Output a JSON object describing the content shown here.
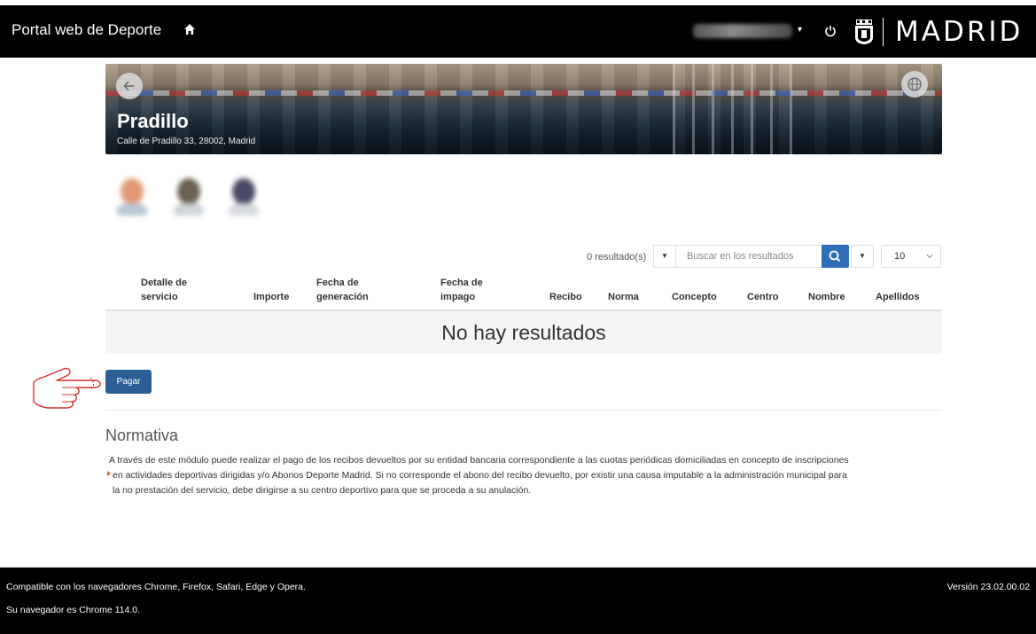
{
  "header": {
    "app_title": "Portal web de Deporte",
    "brand_name": "MADRID",
    "icons": [
      "home-icon",
      "caret-down-icon",
      "power-icon",
      "madrid-crest-icon"
    ]
  },
  "facility": {
    "name": "Pradillo",
    "address": "Calle de Pradillo 33, 28002, Madrid",
    "icons": [
      "arrow-left-icon",
      "globe-icon"
    ]
  },
  "toolbar": {
    "results_count": "0 resultado(s)",
    "search_placeholder": "Buscar en los resultados",
    "page_size": "10",
    "icons": [
      "caret-down-icon",
      "search-icon",
      "chevron-down-icon"
    ]
  },
  "table": {
    "columns": [
      "Detalle de\nservicio",
      "Importe",
      "Fecha de\ngeneración",
      "Fecha de\nimpago",
      "Recibo",
      "Norma",
      "Concepto",
      "Centro",
      "Nombre",
      "Apellidos"
    ],
    "empty_message": "No hay resultados"
  },
  "actions": {
    "pay_label": "Pagar"
  },
  "normativa": {
    "title": "Normativa",
    "lines": [
      "A través de este módulo puede realizar el pago de los recibos devueltos por su entidad bancaria correspondiente a las cuotas periódicas domiciliadas en concepto de inscripciones",
      "en actividades deportivas dirigidas y/o Abonos Deporte Madrid. Si no corresponde el abono del recibo devuelto, por existir una causa imputable a la administración municipal para",
      "la no prestación del servicio, debe dirigirse a su centro deportivo para que se proceda a su anulación."
    ]
  },
  "footer": {
    "compat": "Compatible con los navegadores Chrome, Firefox, Safari, Edge y Opera.",
    "browser": "Su navegador es Chrome 114.0.",
    "version": "Versión 23.02.00.02"
  },
  "colors": {
    "topbar": "#000000",
    "primary_blue": "#2e6fb8",
    "pay_button": "#2a5f95",
    "bullet_orange": "#e0611a",
    "hand_annotation_red": "#d9302a"
  }
}
